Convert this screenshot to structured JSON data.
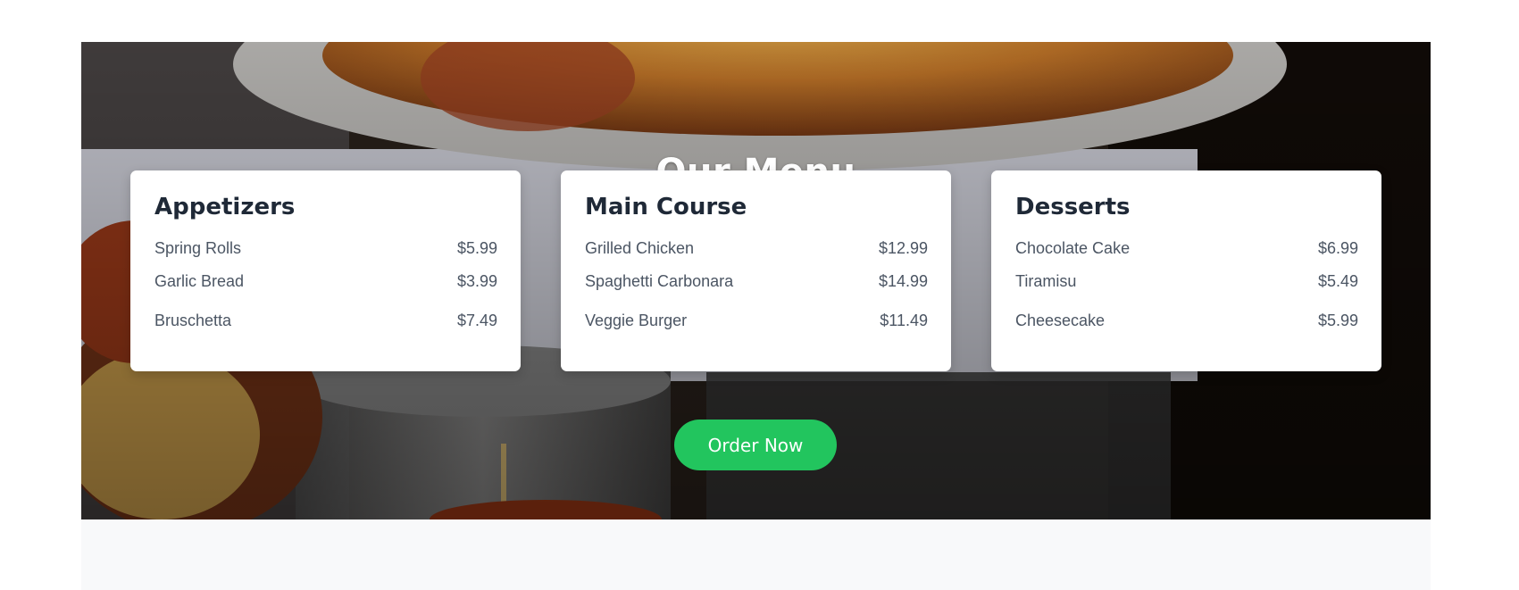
{
  "section": {
    "title": "Our Menu",
    "cta_label": "Order Now",
    "accent_color": "#22c55e"
  },
  "menu": {
    "categories": [
      {
        "name": "Appetizers",
        "items": [
          {
            "name": "Spring Rolls",
            "price": "$5.99"
          },
          {
            "name": "Garlic Bread",
            "price": "$3.99"
          },
          {
            "name": "Bruschetta",
            "price": "$7.49"
          }
        ]
      },
      {
        "name": "Main Course",
        "items": [
          {
            "name": "Grilled Chicken",
            "price": "$12.99"
          },
          {
            "name": "Spaghetti Carbonara",
            "price": "$14.99"
          },
          {
            "name": "Veggie Burger",
            "price": "$11.49"
          }
        ]
      },
      {
        "name": "Desserts",
        "items": [
          {
            "name": "Chocolate Cake",
            "price": "$6.99"
          },
          {
            "name": "Tiramisu",
            "price": "$5.49"
          },
          {
            "name": "Cheesecake",
            "price": "$5.99"
          }
        ]
      }
    ]
  }
}
